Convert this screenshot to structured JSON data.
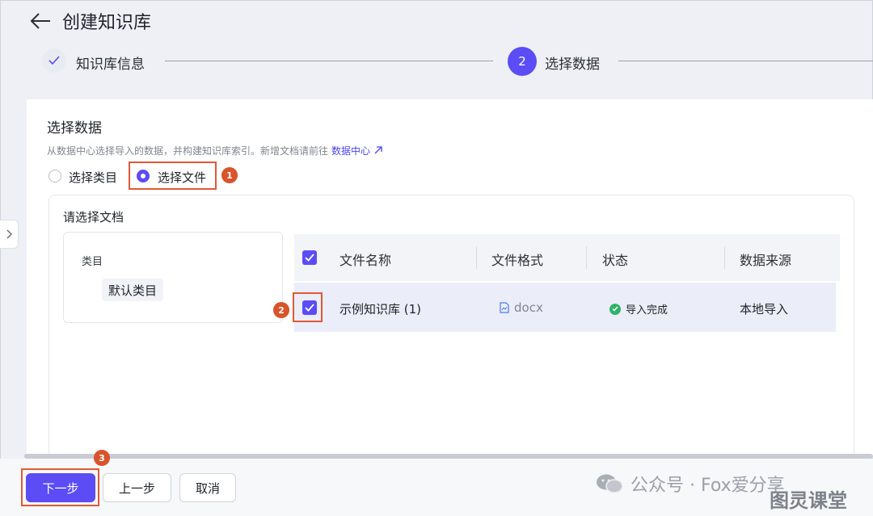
{
  "header": {
    "title": "创建知识库"
  },
  "steps": [
    {
      "label": "知识库信息",
      "status": "done"
    },
    {
      "number": "2",
      "label": "选择数据",
      "status": "active"
    }
  ],
  "section": {
    "title": "选择数据",
    "description": "从数据中心选择导入的数据，并构建知识库索引。新增文档请前往",
    "link_label": "数据中心"
  },
  "source_mode": {
    "options": [
      "选择类目",
      "选择文件"
    ],
    "selected": "选择文件"
  },
  "panel": {
    "title": "请选择文档",
    "category_header": "类目",
    "category_item": "默认类目"
  },
  "table": {
    "columns": [
      "文件名称",
      "文件格式",
      "状态",
      "数据来源"
    ],
    "rows": [
      {
        "name": "示例知识库 (1)",
        "format": "docx",
        "status": "导入完成",
        "source": "本地导入",
        "checked": true
      }
    ]
  },
  "annotations": [
    "1",
    "2",
    "3"
  ],
  "footer": {
    "next_label": "下一步",
    "prev_label": "上一步",
    "cancel_label": "取消"
  },
  "watermark": {
    "line1": "公众号 · Fox爱分享",
    "line2": "图灵课堂"
  },
  "colors": {
    "accent": "#5b4cf5",
    "annotation": "#e05a36",
    "success": "#2fb36b"
  }
}
